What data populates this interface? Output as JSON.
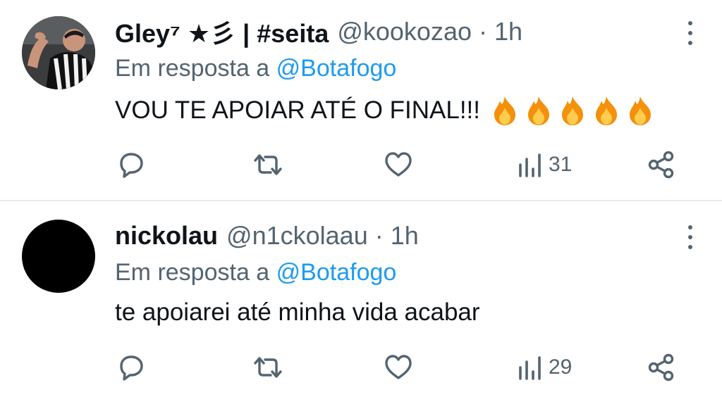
{
  "tweets": [
    {
      "display_name": "Gley⁷ ★彡 | #seita",
      "handle": "@kookozao",
      "separator": "·",
      "time": "1h",
      "reply_prefix": "Em resposta a",
      "reply_to": "@Botafogo",
      "text": "VOU TE APOIAR ATÉ O FINAL!!!",
      "emoji": [
        "fire-icon",
        "fire-icon",
        "fire-icon",
        "fire-icon",
        "fire-icon"
      ],
      "views": "31"
    },
    {
      "display_name": "nickolau",
      "handle": "@n1ckolaau",
      "separator": "·",
      "time": "1h",
      "reply_prefix": "Em resposta a",
      "reply_to": "@Botafogo",
      "text": "te apoiarei até minha vida acabar",
      "emoji": [],
      "views": "29"
    }
  ],
  "colors": {
    "text_primary": "#0f1419",
    "text_secondary": "#536471",
    "link": "#1d9bf0",
    "divider": "#e6ebef"
  }
}
